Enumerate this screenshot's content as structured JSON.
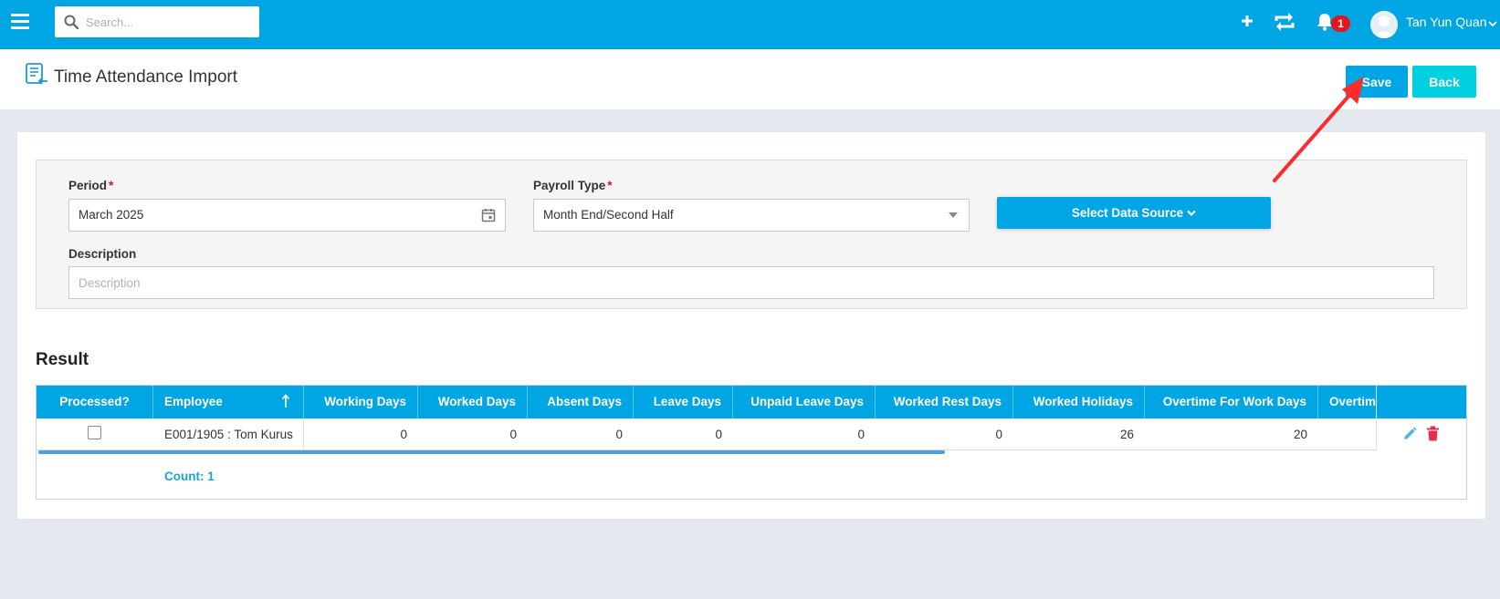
{
  "topbar": {
    "search_placeholder": "Search...",
    "notification_count": "1",
    "user_name": "Tan Yun Quan",
    "bg_color": "#00a6e4"
  },
  "header": {
    "title": "Time Attendance Import",
    "save_label": "Save",
    "back_label": "Back"
  },
  "form": {
    "period_label": "Period",
    "period_value": "March 2025",
    "payroll_type_label": "Payroll Type",
    "payroll_type_value": "Month End/Second Half",
    "required_mark": "*",
    "data_source_label": "Select Data Source",
    "description_label": "Description",
    "description_placeholder": "Description"
  },
  "result": {
    "title": "Result",
    "columns": [
      "Processed?",
      "Employee",
      "Working Days",
      "Worked Days",
      "Absent Days",
      "Leave Days",
      "Unpaid Leave Days",
      "Worked Rest Days",
      "Worked Holidays",
      "Overtime For Work Days",
      "Overtime"
    ],
    "rows": [
      {
        "processed": false,
        "employee": "E001/1905 : Tom Kurus",
        "working_days": "0",
        "worked_days": "0",
        "absent_days": "0",
        "leave_days": "0",
        "unpaid_leave_days": "0",
        "worked_rest_days": "0",
        "worked_holidays": "26",
        "overtime_for_work_days": "20"
      }
    ],
    "count_label": "Count: 1"
  },
  "annotation": {
    "arrow_color": "#ff2a2a"
  }
}
